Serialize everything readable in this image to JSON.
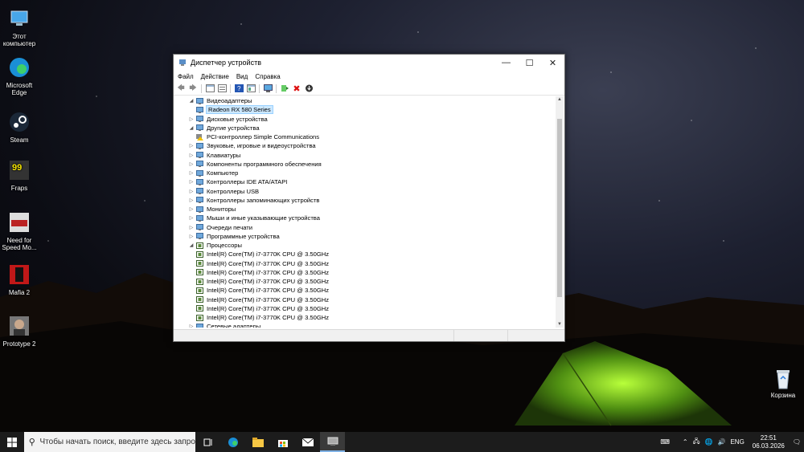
{
  "desktop": {
    "icons": [
      {
        "label": "Этот компьютер",
        "icon": "this-pc-icon"
      },
      {
        "label": "Microsoft Edge",
        "icon": "edge-icon"
      },
      {
        "label": "Steam",
        "icon": "steam-icon"
      },
      {
        "label": "Fraps",
        "icon": "fraps-icon"
      },
      {
        "label": "Need for Speed Mo...",
        "icon": "nfs-icon"
      },
      {
        "label": "Mafia 2",
        "icon": "mafia-icon"
      },
      {
        "label": "Prototype 2",
        "icon": "prototype-icon"
      }
    ],
    "recycle_bin": "Корзина"
  },
  "window": {
    "title": "Диспетчер устройств",
    "menu": [
      "Файл",
      "Действие",
      "Вид",
      "Справка"
    ],
    "tree": [
      {
        "label": "Видеоадаптеры",
        "level": 0,
        "expanded": true
      },
      {
        "label": "Radeon RX 580 Series",
        "level": 1,
        "selected": true
      },
      {
        "label": "Дисковые устройства",
        "level": 0,
        "expanded": false
      },
      {
        "label": "Другие устройства",
        "level": 0,
        "expanded": true
      },
      {
        "label": "PCI-контроллер Simple Communications",
        "level": 1,
        "warning": true
      },
      {
        "label": "Звуковые, игровые и видеоустройства",
        "level": 0,
        "expanded": false
      },
      {
        "label": "Клавиатуры",
        "level": 0,
        "expanded": false
      },
      {
        "label": "Компоненты программного обеспечения",
        "level": 0,
        "expanded": false
      },
      {
        "label": "Компьютер",
        "level": 0,
        "expanded": false
      },
      {
        "label": "Контроллеры IDE ATA/ATAPI",
        "level": 0,
        "expanded": false
      },
      {
        "label": "Контроллеры USB",
        "level": 0,
        "expanded": false
      },
      {
        "label": "Контроллеры запоминающих устройств",
        "level": 0,
        "expanded": false
      },
      {
        "label": "Мониторы",
        "level": 0,
        "expanded": false
      },
      {
        "label": "Мыши и иные указывающие устройства",
        "level": 0,
        "expanded": false
      },
      {
        "label": "Очереди печати",
        "level": 0,
        "expanded": false
      },
      {
        "label": "Программные устройства",
        "level": 0,
        "expanded": false
      },
      {
        "label": "Процессоры",
        "level": 0,
        "expanded": true
      },
      {
        "label": "Intel(R) Core(TM) i7-3770K CPU @ 3.50GHz",
        "level": 1
      },
      {
        "label": "Intel(R) Core(TM) i7-3770K CPU @ 3.50GHz",
        "level": 1
      },
      {
        "label": "Intel(R) Core(TM) i7-3770K CPU @ 3.50GHz",
        "level": 1
      },
      {
        "label": "Intel(R) Core(TM) i7-3770K CPU @ 3.50GHz",
        "level": 1
      },
      {
        "label": "Intel(R) Core(TM) i7-3770K CPU @ 3.50GHz",
        "level": 1
      },
      {
        "label": "Intel(R) Core(TM) i7-3770K CPU @ 3.50GHz",
        "level": 1
      },
      {
        "label": "Intel(R) Core(TM) i7-3770K CPU @ 3.50GHz",
        "level": 1
      },
      {
        "label": "Intel(R) Core(TM) i7-3770K CPU @ 3.50GHz",
        "level": 1
      },
      {
        "label": "Сетевые адаптеры",
        "level": 0,
        "expanded": false
      }
    ]
  },
  "taskbar": {
    "search_placeholder": "Чтобы начать поиск, введите здесь запрос",
    "language": "ENG",
    "time": "22:51",
    "date": "06.03.2026"
  }
}
